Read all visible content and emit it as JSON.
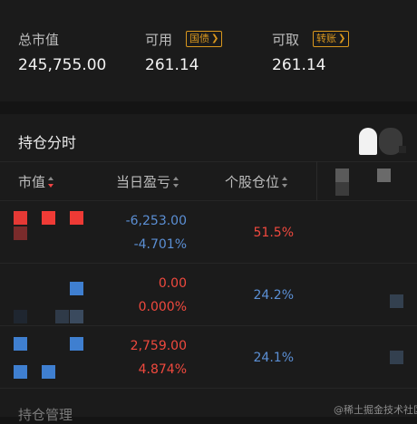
{
  "account": {
    "total_label": "总市值",
    "total_value": "245,755.00",
    "avail_label": "可用",
    "avail_value": "261.14",
    "avail_link": "国债",
    "withdraw_label": "可取",
    "withdraw_value": "261.14",
    "withdraw_link": "转账"
  },
  "holdings": {
    "title": "持仓分时",
    "columns": {
      "market_value": "市值",
      "day_pnl": "当日盈亏",
      "position": "个股仓位"
    },
    "rows": [
      {
        "pnl_amount": "-6,253.00",
        "pnl_percent": "-4.701%",
        "position": "51.5%"
      },
      {
        "pnl_amount": "0.00",
        "pnl_percent": "0.000%",
        "position": "24.2%"
      },
      {
        "pnl_amount": "2,759.00",
        "pnl_percent": "4.874%",
        "position": "24.1%"
      }
    ]
  },
  "footer": {
    "text": "持仓管理"
  },
  "watermark": "@稀土掘金技术社区",
  "colors": {
    "accent": "#d9971d",
    "up": "#f0493e",
    "down": "#5b8fd4"
  }
}
